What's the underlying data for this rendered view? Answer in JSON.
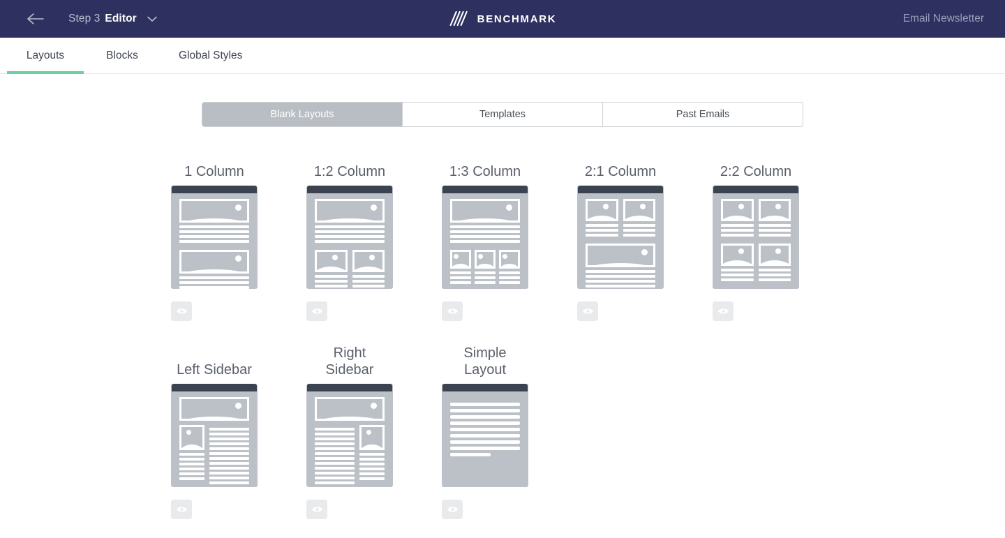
{
  "header": {
    "back_icon": "arrow-left-icon",
    "step_label": "Step 3",
    "step_name": "Editor",
    "dropdown_icon": "chevron-down-icon",
    "brand_name": "BENCHMARK",
    "brand_mark_icon": "benchmark-logo-icon",
    "campaign_name": "Email Newsletter",
    "bg_color": "#2e3160"
  },
  "tabs": {
    "accent_color": "#6ecfa0",
    "items": [
      {
        "label": "Layouts",
        "active": true
      },
      {
        "label": "Blocks",
        "active": false
      },
      {
        "label": "Global Styles",
        "active": false
      }
    ]
  },
  "segmented": {
    "selected_bg": "#b9bec4",
    "options": [
      {
        "label": "Blank Layouts",
        "selected": true
      },
      {
        "label": "Templates",
        "selected": false
      },
      {
        "label": "Past Emails",
        "selected": false
      }
    ]
  },
  "layouts": {
    "preview_icon": "eye-icon",
    "thumb_bg": "#bcc1c7",
    "thumb_header_color": "#3b4351",
    "row1": [
      {
        "title": "1 Column",
        "kind": "one-column"
      },
      {
        "title": "1:2 Column",
        "kind": "one-two-column"
      },
      {
        "title": "1:3 Column",
        "kind": "one-three-column"
      },
      {
        "title": "2:1 Column",
        "kind": "two-one-column"
      },
      {
        "title": "2:2 Column",
        "kind": "two-two-column"
      }
    ],
    "row2": [
      {
        "title": "Left Sidebar",
        "kind": "left-sidebar"
      },
      {
        "title": "Right Sidebar",
        "kind": "right-sidebar"
      },
      {
        "title": "Simple Layout",
        "kind": "simple-layout"
      }
    ]
  }
}
